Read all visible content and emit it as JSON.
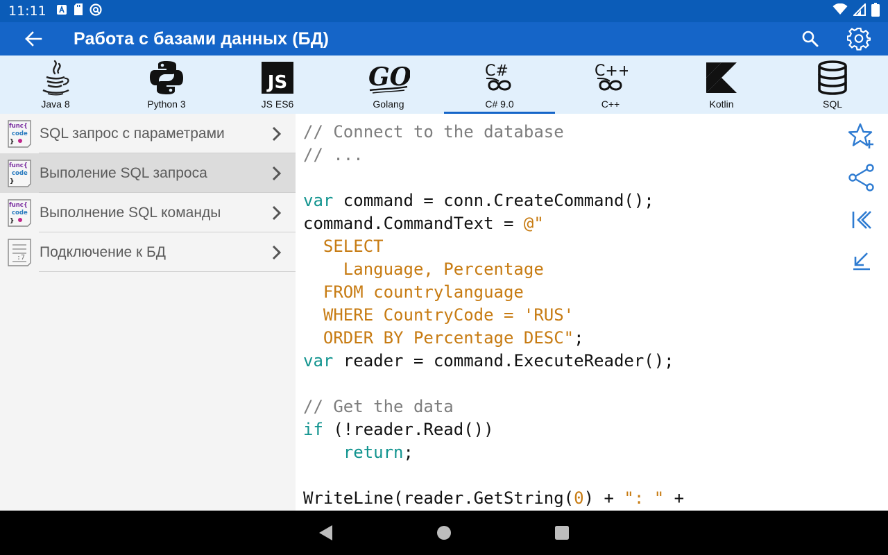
{
  "status_bar": {
    "time": "11:11"
  },
  "app_bar": {
    "title": "Работа с базами данных (БД)"
  },
  "languages": [
    {
      "label": "Java 8",
      "icon": "java-icon",
      "active": false
    },
    {
      "label": "Python 3",
      "icon": "python-icon",
      "active": false
    },
    {
      "label": "JS ES6",
      "icon": "javascript-icon",
      "active": false
    },
    {
      "label": "Golang",
      "icon": "golang-icon",
      "active": false
    },
    {
      "label": "C# 9.0",
      "icon": "csharp-icon",
      "active": true
    },
    {
      "label": "C++",
      "icon": "cpp-icon",
      "active": false
    },
    {
      "label": "Kotlin",
      "icon": "kotlin-icon",
      "active": false
    },
    {
      "label": "SQL",
      "icon": "database-icon",
      "active": false
    }
  ],
  "topics": [
    {
      "label": "SQL запрос с параметрами",
      "icon": "func-code-icon",
      "selected": false
    },
    {
      "label": "Выполение SQL запроса",
      "icon": "func-code-icon",
      "selected": true
    },
    {
      "label": "Выполнение SQL команды",
      "icon": "func-code-icon",
      "selected": false
    },
    {
      "label": "Подключение к БД",
      "icon": "note-icon",
      "selected": false
    }
  ],
  "code": {
    "lines": [
      [
        [
          "c",
          "// Connect to the database"
        ]
      ],
      [
        [
          "c",
          "// ..."
        ]
      ],
      [],
      [
        [
          "k",
          "var"
        ],
        [
          "p",
          " command = conn.CreateCommand();"
        ]
      ],
      [
        [
          "p",
          "command.CommandText = "
        ],
        [
          "s",
          "@\""
        ]
      ],
      [
        [
          "s",
          "  SELECT"
        ]
      ],
      [
        [
          "s",
          "    Language, Percentage"
        ]
      ],
      [
        [
          "s",
          "  FROM countrylanguage"
        ]
      ],
      [
        [
          "s",
          "  WHERE CountryCode = 'RUS'"
        ]
      ],
      [
        [
          "s",
          "  ORDER BY Percentage DESC\""
        ],
        [
          "p",
          ";"
        ]
      ],
      [
        [
          "k",
          "var"
        ],
        [
          "p",
          " reader = command.ExecuteReader();"
        ]
      ],
      [],
      [
        [
          "c",
          "// Get the data"
        ]
      ],
      [
        [
          "k",
          "if"
        ],
        [
          "p",
          " (!reader.Read())"
        ]
      ],
      [
        [
          "p",
          "    "
        ],
        [
          "k",
          "return"
        ],
        [
          "p",
          ";"
        ]
      ],
      [],
      [
        [
          "p",
          "WriteLine(reader.GetString("
        ],
        [
          "s",
          "0"
        ],
        [
          "p",
          ") + "
        ],
        [
          "s",
          "\": \""
        ],
        [
          "p",
          " +"
        ]
      ]
    ]
  },
  "colors": {
    "status_bar": "#0b5cb8",
    "app_bar": "#1565c8",
    "tab_background": "#e2f0fc",
    "accent": "#1565c8",
    "code_keyword": "#12948f",
    "code_string": "#c77b12",
    "code_comment": "#7d7d7d"
  }
}
